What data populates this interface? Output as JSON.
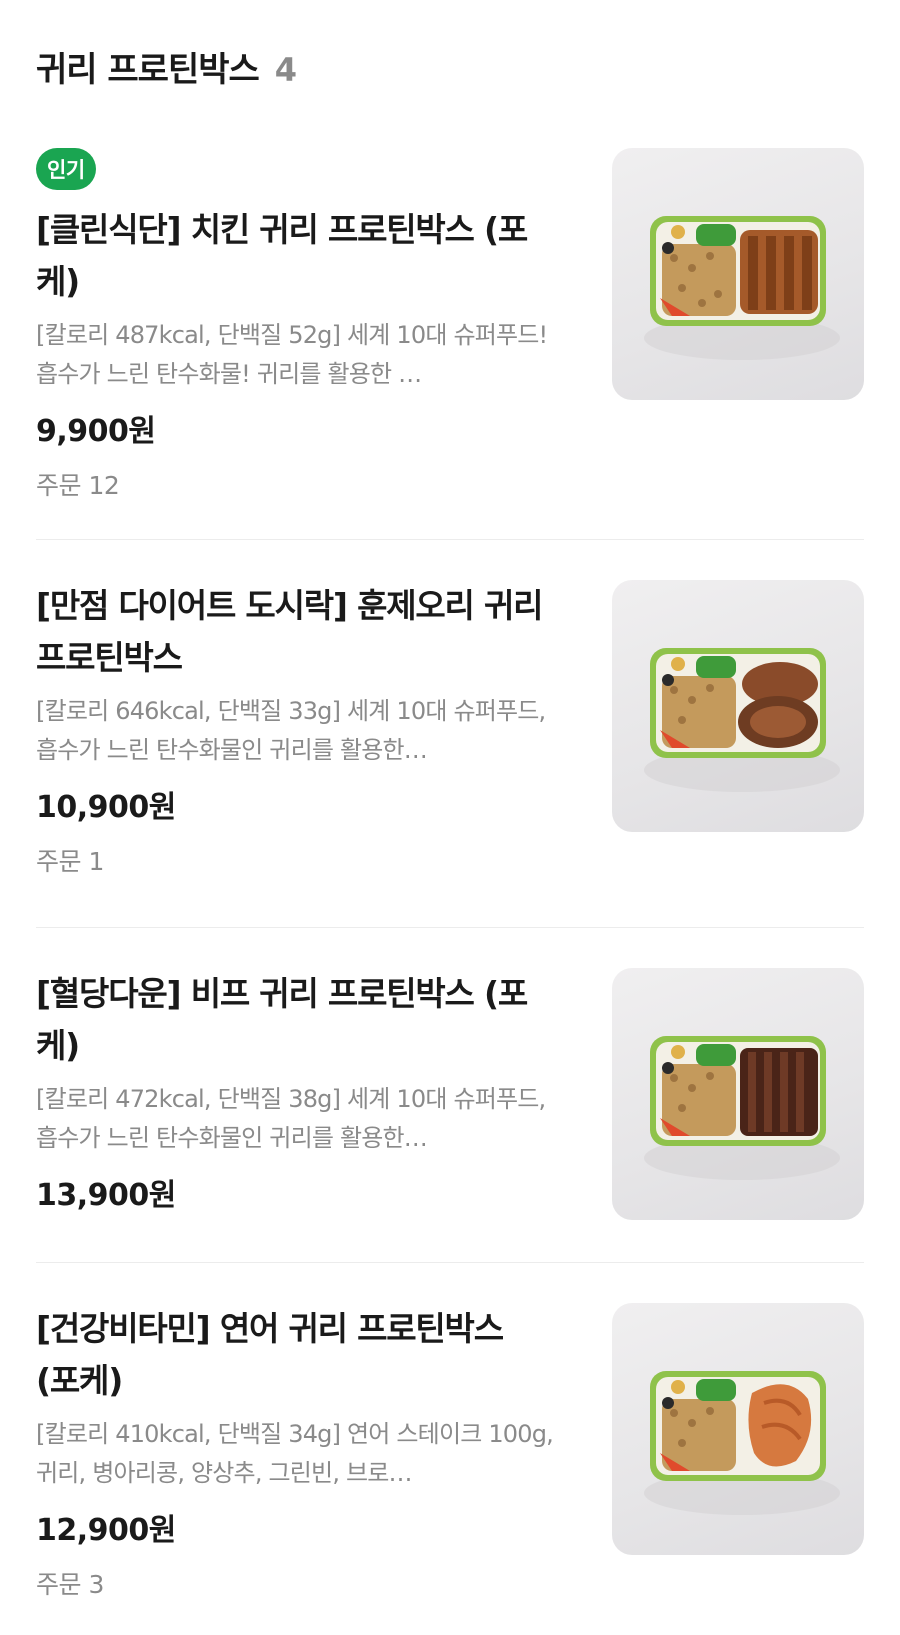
{
  "section": {
    "title": "귀리 프로틴박스",
    "count": "4"
  },
  "items": [
    {
      "badge": "인기",
      "name": "[클린식단] 치킨 귀리 프로틴박스 (포케)",
      "description": "[칼로리 487kcal, 단백질 52g] 세계 10대 슈퍼푸드! 흡수가 느린 탄수화물! 귀리를 활용한 …",
      "price": "9,900원",
      "orders": "주문 12",
      "image_icon": "chicken-protein-box-photo"
    },
    {
      "badge": "",
      "name": "[만점 다이어트 도시락] 훈제오리 귀리 프로틴박스",
      "description": "[칼로리 646kcal, 단백질 33g] 세계 10대 슈퍼푸드, 흡수가 느린 탄수화물인 귀리를 활용한…",
      "price": "10,900원",
      "orders": "주문 1",
      "image_icon": "duck-protein-box-photo"
    },
    {
      "badge": "",
      "name": "[혈당다운] 비프 귀리 프로틴박스 (포케)",
      "description": "[칼로리 472kcal, 단백질 38g] 세계 10대 슈퍼푸드, 흡수가 느린 탄수화물인 귀리를 활용한…",
      "price": "13,900원",
      "orders": "",
      "image_icon": "beef-protein-box-photo"
    },
    {
      "badge": "",
      "name": "[건강비타민] 연어 귀리 프로틴박스 (포케)",
      "description": "[칼로리 410kcal, 단백질 34g] 연어 스테이크 100g, 귀리, 병아리콩, 양상추, 그린빈, 브로…",
      "price": "12,900원",
      "orders": "주문 3",
      "image_icon": "salmon-protein-box-photo"
    }
  ],
  "colors": {
    "badge": "#1aa551",
    "muted_text": "#8a8a8a",
    "primary_text": "#1a1a1a",
    "divider": "#ececec"
  }
}
